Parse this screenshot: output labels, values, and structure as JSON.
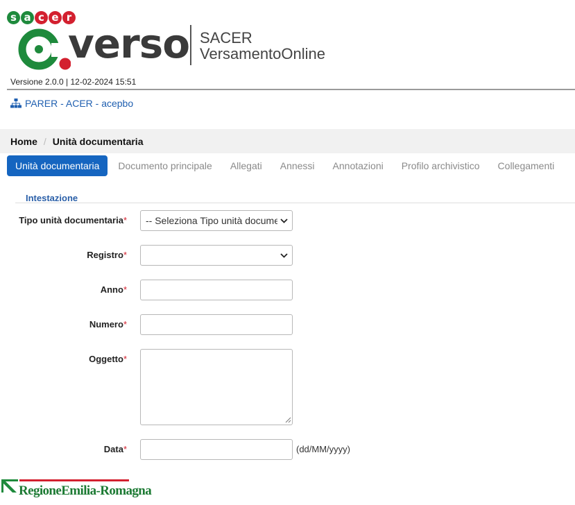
{
  "header": {
    "sacer_letters": [
      "s",
      "a",
      "c",
      "e",
      "r"
    ],
    "logo_word": "verso",
    "app_name": "SACER",
    "app_subtitle": "VersamentoOnline",
    "version_text": "Versione 2.0.0 | 12-02-2024 15:51",
    "org_link": "PARER - ACER - acepbo",
    "colors": {
      "green": "#1e8a3c",
      "red": "#d3202f",
      "link": "#1f5fb0"
    }
  },
  "breadcrumb": {
    "home": "Home",
    "current": "Unità documentaria"
  },
  "tabs": [
    {
      "label": "Unità documentaria",
      "active": true
    },
    {
      "label": "Documento principale",
      "active": false
    },
    {
      "label": "Allegati",
      "active": false
    },
    {
      "label": "Annessi",
      "active": false
    },
    {
      "label": "Annotazioni",
      "active": false
    },
    {
      "label": "Profilo archivistico",
      "active": false
    },
    {
      "label": "Collegamenti",
      "active": false
    }
  ],
  "form": {
    "section_title": "Intestazione",
    "required_mark": "*",
    "fields": {
      "tipo": {
        "label": "Tipo unità documentaria",
        "value": "-- Seleziona Tipo unità documentaria"
      },
      "registro": {
        "label": "Registro",
        "value": ""
      },
      "anno": {
        "label": "Anno",
        "value": ""
      },
      "numero": {
        "label": "Numero",
        "value": ""
      },
      "oggetto": {
        "label": "Oggetto",
        "value": ""
      },
      "data": {
        "label": "Data",
        "value": "",
        "hint": "(dd/MM/yyyy)"
      }
    }
  },
  "footer": {
    "logo_text": "RegioneEmilia-Romagna"
  }
}
